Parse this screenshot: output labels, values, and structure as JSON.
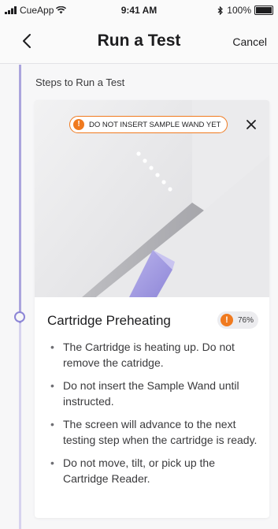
{
  "status_bar": {
    "carrier": "CueApp",
    "time": "9:41 AM",
    "battery": "100%"
  },
  "nav": {
    "title": "Run a Test",
    "cancel_label": "Cancel",
    "back_icon": "chevron-left-icon"
  },
  "section_label": "Steps to Run a Test",
  "step": {
    "warning": "DO NOT INSERT SAMPLE WAND YET",
    "title": "Cartridge Preheating",
    "progress": "76%",
    "progress_value": 0.76,
    "bullets": [
      "The Cartridge is heating up. Do not remove the catridge.",
      "Do not insert the Sample Wand until instructed.",
      "The screen will advance to the next testing step when the cartridge is ready.",
      "Do not move, tilt, or pick up the Cartridge Reader."
    ]
  },
  "colors": {
    "accent_purple": "#8c85d6",
    "warning_orange": "#f07a1f",
    "timeline": "#aba5dd"
  }
}
